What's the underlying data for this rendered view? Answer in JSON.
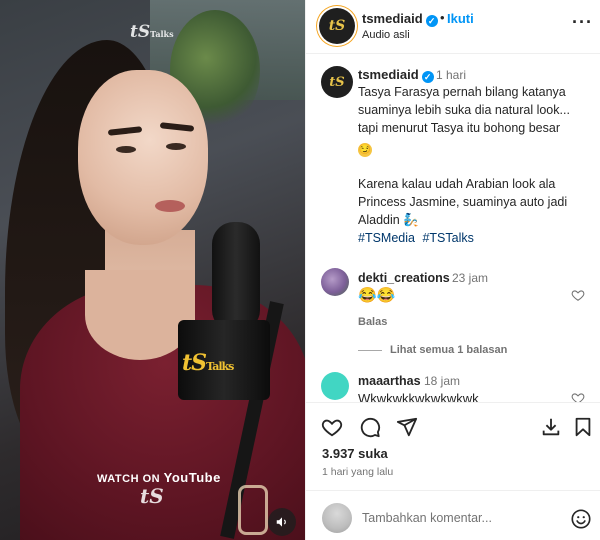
{
  "video": {
    "watermark_top": "tS",
    "watermark_top_sub": "Talks",
    "mic_logo": "tS",
    "mic_logo_sub": "Talks",
    "watch_on": "WATCH ON",
    "youtube": "YouTube",
    "watermark_bottom": "tS",
    "sound_icon": "speaker-icon"
  },
  "post": {
    "author": "tsmediaid",
    "avatar_text": "tS",
    "follow_label": "Ikuti",
    "audio": "Audio asli",
    "separator": "•"
  },
  "caption": {
    "author": "tsmediaid",
    "time": "1 hari",
    "text_part1": "Tasya Farasya pernah bilang katanya suaminya lebih suka dia natural look... tapi menurut Tasya itu bohong besar",
    "emoji1": "😏",
    "text_part2": "Karena kalau udah Arabian look ala Princess Jasmine, suaminya auto jadi Aladdin",
    "emoji2": "🧞",
    "hashtags": [
      "#TSMedia",
      "#TSTalks"
    ]
  },
  "comments": [
    {
      "user": "dekti_creations",
      "time": "23 jam",
      "text": "😂😂",
      "reply_label": "Balas",
      "view_replies": "Lihat semua 1 balasan"
    },
    {
      "user": "maaarthas",
      "time": "18 jam",
      "text": "Wkwkwkkwkwkwkwk"
    }
  ],
  "actions": {
    "like_icon": "heart-icon",
    "comment_icon": "comment-icon",
    "share_icon": "send-icon",
    "save_icon": "download-icon",
    "bookmark_icon": "bookmark-icon"
  },
  "stats": {
    "likes": "3.937 suka",
    "posted": "1 hari yang lalu"
  },
  "add_comment": {
    "placeholder": "Tambahkan komentar..."
  },
  "colors": {
    "accent": "#0095f6",
    "link": "#00376b",
    "muted": "#737373"
  }
}
